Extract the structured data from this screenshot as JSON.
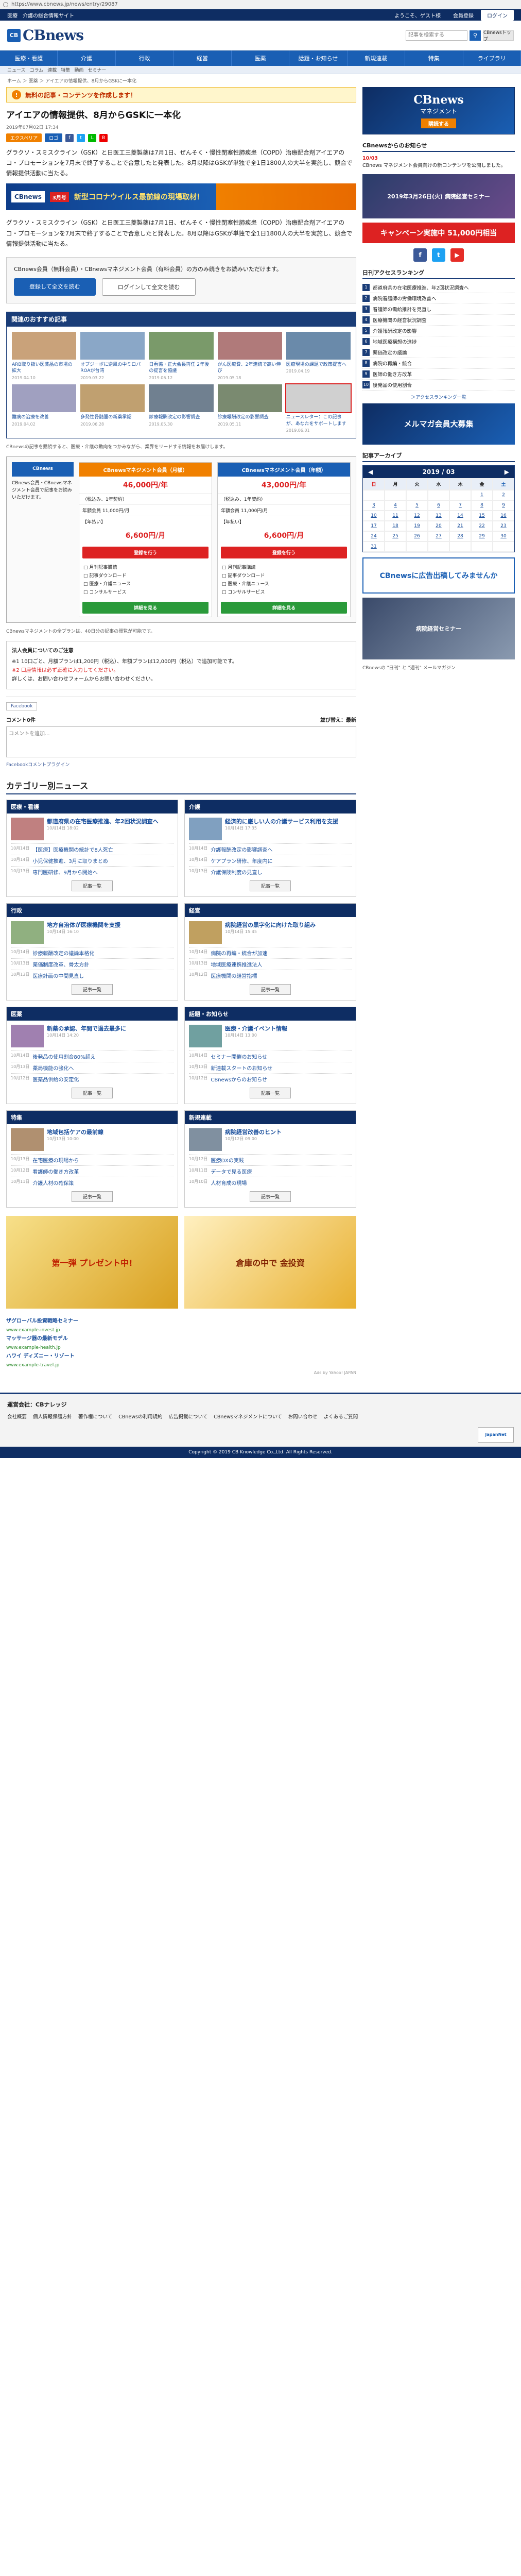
{
  "browser": {
    "url": "https://www.cbnews.jp/news/entry/29087"
  },
  "topbar": {
    "left": [
      "医療",
      "介護の総合情報サイト"
    ],
    "welcome": "ようこそ、ゲスト様",
    "register": "会員登録",
    "login": "ログイン"
  },
  "header": {
    "logo_mark": "CB",
    "logo_text": "CBnews",
    "search_placeholder": "記事を検索する",
    "search_icon": "search-icon",
    "top_button": "CBnewsトップ"
  },
  "nav": [
    "医療・看護",
    "介護",
    "行政",
    "経営",
    "医薬",
    "話題・お知らせ",
    "新規連載",
    "特集",
    "ライブラリ"
  ],
  "subnav": [
    "ニュース",
    "コラム",
    "連載",
    "特集",
    "動画",
    "セミナー"
  ],
  "breadcrumb": "ホーム ＞ 医薬 ＞ アイエアの情報提供、8月からGSKに一本化",
  "article": {
    "alert": "無料の記事・コンテンツを作成します！",
    "title": "アイエアの情報提供、8月からGSKに一本化",
    "date": "2019年07月02日 17:34",
    "tag1": "エクスペリア",
    "tag2": "ロゴ",
    "para1": "グラクソ・スミスクライン（GSK）と日医工三菱製薬は7月1日、ぜんそく・慢性閉塞性肺疾患（COPD）治療配合剤アイエアのコ・プロモーションを7月末で終了することで合意したと発表した。8月以降はGSKが単独で全1日1800人の大半を実施し、競合で情報提供活動に当たる。",
    "banner_logo": "CBnews",
    "banner_badge": "3月号",
    "banner_text": "新型コロナウイルス最前線の現場取材！",
    "para2": "グラクソ・スミスクライン（GSK）と日医工三菱製薬は7月1日、ぜんそく・慢性閉塞性肺疾患（COPD）治療配合剤アイエアのコ・プロモーションを7月末で終了することで合意したと発表した。8月以降はGSKが単独で全1日1800人の大半を実施し、競合で情報提供活動に当たる。",
    "reg_note": "CBnews会員（無料会員）・CBnewsマネジメント会員（有料会員）の方のみ続きをお読みいただけます。",
    "reg_btn": "登録して全文を読む",
    "login_btn": "ログインして全文を読む"
  },
  "reco": {
    "heading": "関連のおすすめ記事",
    "items": [
      {
        "title": "ARB取り扱い医薬品の市場の拡大",
        "date": "2019.04.10",
        "color": "#c9a27a"
      },
      {
        "title": "オプジーボに逆風の中ミロバ ROAが台湾",
        "date": "2019.03.22",
        "color": "#8aa7c7"
      },
      {
        "title": "日看協・正大会長再任 2年後の提言を協議",
        "date": "2019.06.12",
        "color": "#7a9a6a"
      },
      {
        "title": "がん医療費、2年連続で高い伸び",
        "date": "2019.05.18",
        "color": "#b07a7a"
      },
      {
        "title": "医療現場の課題で政策提言へ",
        "date": "2019.04.19",
        "color": "#6a8aaa"
      },
      {
        "title": "難病の治療を改善",
        "date": "2019.04.02",
        "color": "#a0a0c0"
      },
      {
        "title": "多発性骨髄腫の新薬承認",
        "date": "2019.06.28",
        "color": "#c0a070"
      },
      {
        "title": "診療報酬改定の影響調査",
        "date": "2019.05.30",
        "color": "#708090"
      },
      {
        "title": "診療報酬改定の影響調査",
        "date": "2019.05.11",
        "color": "#7a8a70"
      },
      {
        "title": "ニュースレター：この記事が、あなたをサポートします",
        "date": "2019.06.01",
        "color": "#d0d0d0"
      }
    ]
  },
  "pricing": {
    "note": "CBnewsの記事を購読すると、医療・介護の動向をつかみながら、業界をリードする情報をお届けします。",
    "left_logo": "CBnews",
    "left_text": "CBnews会員・CBnewsマネジメント会員で記事をお読みいただけます。",
    "plan1": {
      "head": "CBnewsマネジメント会員（月額）",
      "price": "46,000円/年",
      "sub": "（税込み、1年契約）",
      "rows": [
        "年額会員 11,000円/月",
        "【年払い】"
      ],
      "btn": "登録を行う"
    },
    "plan2": {
      "head": "CBnewsマネジメント会員（年額）",
      "price": "43,000円/年",
      "sub": "（税込み、1年契約）",
      "rows": [
        "年額会員 11,000円/月",
        "【年払い】"
      ],
      "btn": "登録を行う"
    },
    "plan3_price": "6,600円/月",
    "plan4_price": "6,600円/月",
    "service_list": [
      "□ 月刊記事購読",
      "□ 記事ダウンロード",
      "□ 医療・介護ニュース",
      "□ コンサルサービス"
    ],
    "green_btn": "詳細を見る"
  },
  "management_note": "CBnewsマネジメントの全プランは、40日分の記事の閲覧が可能です。",
  "pro": {
    "title": "法人会員についてのご注意",
    "line1": "※1 10口ごと、月額プランは1,200円（税込）、年額プランは12,000円（税込）で追加可能です。",
    "line2": "※2 口座情報は必ず正確に入力してください。",
    "line3": "詳しくは、お問い合わせフォームからお問い合わせください。"
  },
  "comment": {
    "fb": "Facebook",
    "head": "コメント0件",
    "sort": "並び替え：最新",
    "placeholder": "コメントを追加...",
    "plugin": "Facebookコメントプラグイン"
  },
  "category": {
    "title": "カテゴリー別ニュース",
    "more": "記事一覧",
    "blocks": [
      {
        "head": "医療・看護",
        "feature": "都道府県の在宅医療推進、年2回状況調査へ",
        "fdate": "10月14日 18:02",
        "color": "#c08080",
        "items": [
          "【医療】医療機関の統計で8人死亡",
          "小児保健推進、3月に取りまとめ",
          "専門医研修、9月から開始へ"
        ],
        "dates": [
          "10月14日",
          "10月14日",
          "10月13日"
        ]
      },
      {
        "head": "介護",
        "feature": "経済的に厳しい人の介護サービス利用を支援",
        "fdate": "10月14日 17:35",
        "color": "#80a0c0",
        "items": [
          "介護報酬改定の影響調査へ",
          "ケアプラン研修、年度内に",
          "介護保険制度の見直し"
        ],
        "dates": [
          "10月14日",
          "10月14日",
          "10月13日"
        ]
      },
      {
        "head": "行政",
        "feature": "地方自治体が医療機関を支援",
        "fdate": "10月14日 16:10",
        "color": "#90b080",
        "items": [
          "診療報酬改定の議論本格化",
          "薬価制度改革、骨太方針",
          "医療計画の中間見直し"
        ],
        "dates": [
          "10月14日",
          "10月13日",
          "10月13日"
        ]
      },
      {
        "head": "経営",
        "feature": "病院経営の黒字化に向けた取り組み",
        "fdate": "10月14日 15:45",
        "color": "#c0a060",
        "items": [
          "病院の再編・統合が加速",
          "地域医療連携推進法人",
          "医療機関の経営指標"
        ],
        "dates": [
          "10月14日",
          "10月13日",
          "10月12日"
        ]
      },
      {
        "head": "医薬",
        "feature": "新薬の承認、年間で過去最多に",
        "fdate": "10月14日 14:20",
        "color": "#a080b0",
        "items": [
          "後発品の使用割合80%超え",
          "薬局機能の強化へ",
          "医薬品供給の安定化"
        ],
        "dates": [
          "10月14日",
          "10月13日",
          "10月12日"
        ]
      },
      {
        "head": "話題・お知らせ",
        "feature": "医療・介護イベント情報",
        "fdate": "10月14日 13:00",
        "color": "#70a0a0",
        "items": [
          "セミナー開催のお知らせ",
          "新連載スタートのお知らせ",
          "CBnewsからのお知らせ"
        ],
        "dates": [
          "10月14日",
          "10月13日",
          "10月12日"
        ]
      },
      {
        "head": "特集",
        "feature": "地域包括ケアの最前線",
        "fdate": "10月13日 10:00",
        "color": "#b09070",
        "items": [
          "在宅医療の現場から",
          "看護師の働き方改革",
          "介護人材の確保策"
        ],
        "dates": [
          "10月13日",
          "10月12日",
          "10月11日"
        ]
      },
      {
        "head": "新規連載",
        "feature": "病院経営改善のヒント",
        "fdate": "10月12日 09:00",
        "color": "#8090a0",
        "items": [
          "医療DXの実践",
          "データで見る医療",
          "人材育成の現場"
        ],
        "dates": [
          "10月12日",
          "10月11日",
          "10月10日"
        ]
      }
    ]
  },
  "ads": {
    "ad1": "第一弾 プレゼント中!",
    "ad2": "倉庫の中で 金投資",
    "list": [
      {
        "title": "ザグローバル投資戦略セミナー",
        "url": "www.example-invest.jp"
      },
      {
        "title": "マッサージ器の最新モデル",
        "url": "www.example-health.jp"
      },
      {
        "title": "ハワイ ディズニー・リゾート",
        "url": "www.example-travel.jp"
      }
    ],
    "by": "Ads by Yahoo! JAPAN"
  },
  "sidebar": {
    "banner_logo": "CBnews",
    "banner_sub": "マネジメント",
    "banner_btn": "購読する",
    "notice_head": "CBnewsからのお知らせ",
    "notice_date": "10/03",
    "notice_text": "CBnews マネジメント会員向けの新コンテンツを公開しました。",
    "ad1": "2019年3月26日(火) 病院経営セミナー",
    "ad2": "キャンペーン実施中 51,000円相当",
    "ranking_head": "日刊アクセスランキング",
    "ranking": [
      "都道府県の在宅医療推進、年2回状況調査へ",
      "病院看護師の労働環境改善へ",
      "看護師の需給推計を見直し",
      "医療機関の経営状況調査",
      "介護報酬改定の影響",
      "地域医療構想の進捗",
      "薬価改定の議論",
      "病院の再編・統合",
      "医師の働き方改革",
      "後発品の使用割合"
    ],
    "ranking_more": "＞アクセスランキング一覧",
    "ad3": "メルマガ会員大募集",
    "calendar_head": "記事アーカイブ",
    "calendar_month": "2019 / 03",
    "dows": [
      "日",
      "月",
      "火",
      "水",
      "木",
      "金",
      "土"
    ],
    "days": [
      "",
      "",
      "",
      "",
      "",
      "1",
      "2",
      "3",
      "4",
      "5",
      "6",
      "7",
      "8",
      "9",
      "10",
      "11",
      "12",
      "13",
      "14",
      "15",
      "16",
      "17",
      "18",
      "19",
      "20",
      "21",
      "22",
      "23",
      "24",
      "25",
      "26",
      "27",
      "28",
      "29",
      "30",
      "31",
      "",
      "",
      "",
      "",
      "",
      ""
    ],
    "ad4": "CBnewsに広告出稿してみませんか",
    "ad5": "病院経営セミナー",
    "side_note": "CBnewsの \"日刊\" と \"週刊\" メールマガジン"
  },
  "footer": {
    "op": "運営会社：CBナレッジ",
    "links": [
      "会社概要",
      "個人情報保護方針",
      "著作権について",
      "CBnewsの利用規約",
      "広告掲載について",
      "CBnewsマネジメントについて",
      "お問い合わせ",
      "よくあるご質問"
    ],
    "badge": "JapanNet",
    "copyright": "Copyright © 2019 CB Knowledge Co.,Ltd. All Rights Reserved."
  }
}
